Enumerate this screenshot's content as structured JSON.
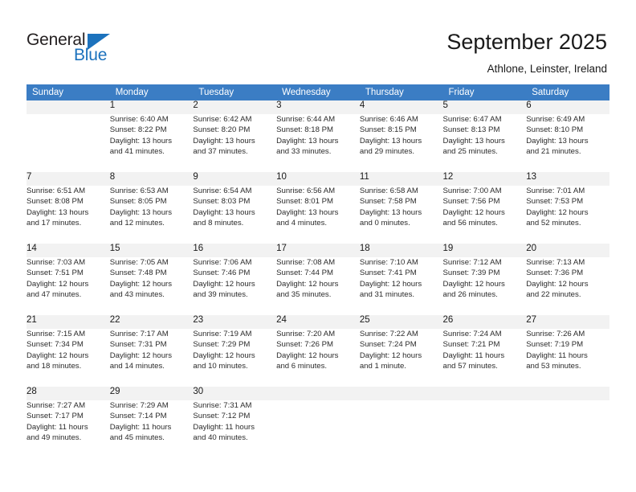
{
  "brand": {
    "name_part1": "General",
    "name_part2": "Blue",
    "triangle_color": "#1c72bd",
    "text_color": "#231f20"
  },
  "header": {
    "title": "September 2025",
    "location": "Athlone, Leinster, Ireland"
  },
  "theme": {
    "header_row_bg": "#3b7dc4",
    "header_row_text": "#ffffff",
    "daynum_bg": "#f2f2f2",
    "separator": "#3b7dc4",
    "body_text": "#2b2b2b"
  },
  "weekdays": [
    "Sunday",
    "Monday",
    "Tuesday",
    "Wednesday",
    "Thursday",
    "Friday",
    "Saturday"
  ],
  "weeks": [
    [
      {
        "day": "",
        "sunrise": "",
        "sunset": "",
        "daylight1": "",
        "daylight2": ""
      },
      {
        "day": "1",
        "sunrise": "Sunrise: 6:40 AM",
        "sunset": "Sunset: 8:22 PM",
        "daylight1": "Daylight: 13 hours",
        "daylight2": "and 41 minutes."
      },
      {
        "day": "2",
        "sunrise": "Sunrise: 6:42 AM",
        "sunset": "Sunset: 8:20 PM",
        "daylight1": "Daylight: 13 hours",
        "daylight2": "and 37 minutes."
      },
      {
        "day": "3",
        "sunrise": "Sunrise: 6:44 AM",
        "sunset": "Sunset: 8:18 PM",
        "daylight1": "Daylight: 13 hours",
        "daylight2": "and 33 minutes."
      },
      {
        "day": "4",
        "sunrise": "Sunrise: 6:46 AM",
        "sunset": "Sunset: 8:15 PM",
        "daylight1": "Daylight: 13 hours",
        "daylight2": "and 29 minutes."
      },
      {
        "day": "5",
        "sunrise": "Sunrise: 6:47 AM",
        "sunset": "Sunset: 8:13 PM",
        "daylight1": "Daylight: 13 hours",
        "daylight2": "and 25 minutes."
      },
      {
        "day": "6",
        "sunrise": "Sunrise: 6:49 AM",
        "sunset": "Sunset: 8:10 PM",
        "daylight1": "Daylight: 13 hours",
        "daylight2": "and 21 minutes."
      }
    ],
    [
      {
        "day": "7",
        "sunrise": "Sunrise: 6:51 AM",
        "sunset": "Sunset: 8:08 PM",
        "daylight1": "Daylight: 13 hours",
        "daylight2": "and 17 minutes."
      },
      {
        "day": "8",
        "sunrise": "Sunrise: 6:53 AM",
        "sunset": "Sunset: 8:05 PM",
        "daylight1": "Daylight: 13 hours",
        "daylight2": "and 12 minutes."
      },
      {
        "day": "9",
        "sunrise": "Sunrise: 6:54 AM",
        "sunset": "Sunset: 8:03 PM",
        "daylight1": "Daylight: 13 hours",
        "daylight2": "and 8 minutes."
      },
      {
        "day": "10",
        "sunrise": "Sunrise: 6:56 AM",
        "sunset": "Sunset: 8:01 PM",
        "daylight1": "Daylight: 13 hours",
        "daylight2": "and 4 minutes."
      },
      {
        "day": "11",
        "sunrise": "Sunrise: 6:58 AM",
        "sunset": "Sunset: 7:58 PM",
        "daylight1": "Daylight: 13 hours",
        "daylight2": "and 0 minutes."
      },
      {
        "day": "12",
        "sunrise": "Sunrise: 7:00 AM",
        "sunset": "Sunset: 7:56 PM",
        "daylight1": "Daylight: 12 hours",
        "daylight2": "and 56 minutes."
      },
      {
        "day": "13",
        "sunrise": "Sunrise: 7:01 AM",
        "sunset": "Sunset: 7:53 PM",
        "daylight1": "Daylight: 12 hours",
        "daylight2": "and 52 minutes."
      }
    ],
    [
      {
        "day": "14",
        "sunrise": "Sunrise: 7:03 AM",
        "sunset": "Sunset: 7:51 PM",
        "daylight1": "Daylight: 12 hours",
        "daylight2": "and 47 minutes."
      },
      {
        "day": "15",
        "sunrise": "Sunrise: 7:05 AM",
        "sunset": "Sunset: 7:48 PM",
        "daylight1": "Daylight: 12 hours",
        "daylight2": "and 43 minutes."
      },
      {
        "day": "16",
        "sunrise": "Sunrise: 7:06 AM",
        "sunset": "Sunset: 7:46 PM",
        "daylight1": "Daylight: 12 hours",
        "daylight2": "and 39 minutes."
      },
      {
        "day": "17",
        "sunrise": "Sunrise: 7:08 AM",
        "sunset": "Sunset: 7:44 PM",
        "daylight1": "Daylight: 12 hours",
        "daylight2": "and 35 minutes."
      },
      {
        "day": "18",
        "sunrise": "Sunrise: 7:10 AM",
        "sunset": "Sunset: 7:41 PM",
        "daylight1": "Daylight: 12 hours",
        "daylight2": "and 31 minutes."
      },
      {
        "day": "19",
        "sunrise": "Sunrise: 7:12 AM",
        "sunset": "Sunset: 7:39 PM",
        "daylight1": "Daylight: 12 hours",
        "daylight2": "and 26 minutes."
      },
      {
        "day": "20",
        "sunrise": "Sunrise: 7:13 AM",
        "sunset": "Sunset: 7:36 PM",
        "daylight1": "Daylight: 12 hours",
        "daylight2": "and 22 minutes."
      }
    ],
    [
      {
        "day": "21",
        "sunrise": "Sunrise: 7:15 AM",
        "sunset": "Sunset: 7:34 PM",
        "daylight1": "Daylight: 12 hours",
        "daylight2": "and 18 minutes."
      },
      {
        "day": "22",
        "sunrise": "Sunrise: 7:17 AM",
        "sunset": "Sunset: 7:31 PM",
        "daylight1": "Daylight: 12 hours",
        "daylight2": "and 14 minutes."
      },
      {
        "day": "23",
        "sunrise": "Sunrise: 7:19 AM",
        "sunset": "Sunset: 7:29 PM",
        "daylight1": "Daylight: 12 hours",
        "daylight2": "and 10 minutes."
      },
      {
        "day": "24",
        "sunrise": "Sunrise: 7:20 AM",
        "sunset": "Sunset: 7:26 PM",
        "daylight1": "Daylight: 12 hours",
        "daylight2": "and 6 minutes."
      },
      {
        "day": "25",
        "sunrise": "Sunrise: 7:22 AM",
        "sunset": "Sunset: 7:24 PM",
        "daylight1": "Daylight: 12 hours",
        "daylight2": "and 1 minute."
      },
      {
        "day": "26",
        "sunrise": "Sunrise: 7:24 AM",
        "sunset": "Sunset: 7:21 PM",
        "daylight1": "Daylight: 11 hours",
        "daylight2": "and 57 minutes."
      },
      {
        "day": "27",
        "sunrise": "Sunrise: 7:26 AM",
        "sunset": "Sunset: 7:19 PM",
        "daylight1": "Daylight: 11 hours",
        "daylight2": "and 53 minutes."
      }
    ],
    [
      {
        "day": "28",
        "sunrise": "Sunrise: 7:27 AM",
        "sunset": "Sunset: 7:17 PM",
        "daylight1": "Daylight: 11 hours",
        "daylight2": "and 49 minutes."
      },
      {
        "day": "29",
        "sunrise": "Sunrise: 7:29 AM",
        "sunset": "Sunset: 7:14 PM",
        "daylight1": "Daylight: 11 hours",
        "daylight2": "and 45 minutes."
      },
      {
        "day": "30",
        "sunrise": "Sunrise: 7:31 AM",
        "sunset": "Sunset: 7:12 PM",
        "daylight1": "Daylight: 11 hours",
        "daylight2": "and 40 minutes."
      },
      {
        "day": "",
        "sunrise": "",
        "sunset": "",
        "daylight1": "",
        "daylight2": ""
      },
      {
        "day": "",
        "sunrise": "",
        "sunset": "",
        "daylight1": "",
        "daylight2": ""
      },
      {
        "day": "",
        "sunrise": "",
        "sunset": "",
        "daylight1": "",
        "daylight2": ""
      },
      {
        "day": "",
        "sunrise": "",
        "sunset": "",
        "daylight1": "",
        "daylight2": ""
      }
    ]
  ]
}
